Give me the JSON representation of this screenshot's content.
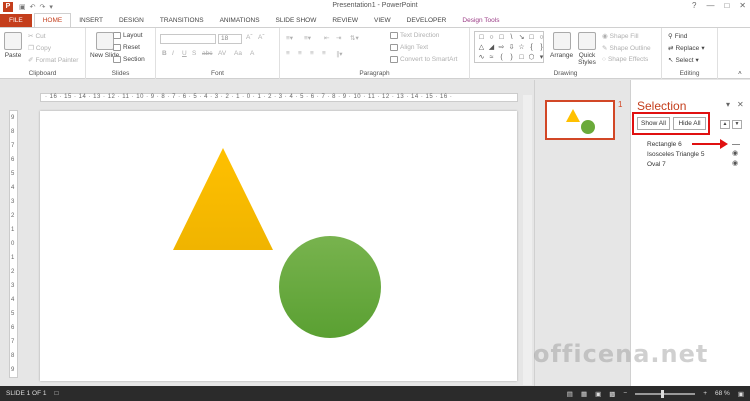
{
  "window": {
    "title": "Presentation1 - PowerPoint",
    "controls": [
      "?",
      "—",
      "□",
      "✕"
    ]
  },
  "tabs": [
    "FILE",
    "HOME",
    "INSERT",
    "DESIGN",
    "TRANSITIONS",
    "ANIMATIONS",
    "SLIDE SHOW",
    "REVIEW",
    "VIEW",
    "DEVELOPER",
    "Design Tools"
  ],
  "ribbon": {
    "clipboard": {
      "label": "Clipboard",
      "paste": "Paste",
      "cut": "Cut",
      "copy": "Copy",
      "format_painter": "Format Painter"
    },
    "slides": {
      "label": "Slides",
      "new_slide": "New Slide",
      "layout": "Layout",
      "reset": "Reset",
      "section": "Section"
    },
    "font": {
      "label": "Font",
      "size": "18",
      "bold": "B",
      "italic": "I",
      "underline": "U",
      "shadow": "S",
      "strike": "abc",
      "spacing": "AV",
      "case": "Aa",
      "color": "A"
    },
    "paragraph": {
      "label": "Paragraph",
      "text_direction": "Text Direction",
      "align_text": "Align Text",
      "convert_smartart": "Convert to SmartArt"
    },
    "drawing": {
      "label": "Drawing",
      "arrange": "Arrange",
      "quick_styles": "Quick Styles",
      "shape_fill": "Shape Fill",
      "shape_outline": "Shape Outline",
      "shape_effects": "Shape Effects"
    },
    "editing": {
      "label": "Editing",
      "find": "Find",
      "replace": "Replace",
      "select": "Select"
    }
  },
  "rulers": {
    "horizontal": "· 16 · 15 · 14 · 13 · 12 · 11 · 10 · 9 · 8 · 7 · 6 · 5 · 4 · 3 · 2 · 1 · 0 · 1 · 2 · 3 · 4 · 5 · 6 · 7 · 8 · 9 · 10 · 11 · 12 · 13 · 14 · 15 · 16 ·",
    "vertical": [
      "9",
      "8",
      "7",
      "6",
      "5",
      "4",
      "3",
      "2",
      "1",
      "0",
      "1",
      "2",
      "3",
      "4",
      "5",
      "6",
      "7",
      "8",
      "9"
    ]
  },
  "thumbnail": {
    "number": "1"
  },
  "selection_pane": {
    "title": "Selection",
    "show_all": "Show All",
    "hide_all": "Hide All",
    "items": [
      "Rectangle 6",
      "Isosceles Triangle 5",
      "Oval 7"
    ]
  },
  "status": {
    "slide": "SLIDE 1 OF 1",
    "zoom": "68 %"
  },
  "watermark": "officena.net",
  "colors": {
    "accent": "#c43e1c",
    "triangle": "#ffc000",
    "oval": "#6aaa3a",
    "highlight": "#e01010"
  }
}
